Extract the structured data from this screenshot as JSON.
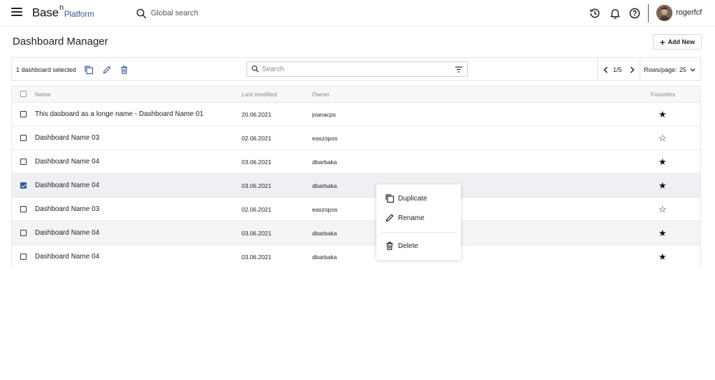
{
  "topbar": {
    "logo_main": "Base",
    "logo_sup": "n",
    "logo_sub": "Platform",
    "search_label": "Global search",
    "username": "rogerfcf",
    "icons": [
      "menu-icon",
      "search-icon",
      "history-icon",
      "bell-icon",
      "help-icon"
    ]
  },
  "page": {
    "title": "Dashboard Manager",
    "add_label": "Add New"
  },
  "toolbar": {
    "selected_text": "1 dashboard selected",
    "search_placeholder": "Search",
    "pager_text": "1/5",
    "rows_label": "Rows/page:",
    "rows_value": "25"
  },
  "table": {
    "headers": {
      "name": "Name",
      "last_modified": "Last modified",
      "owner": "Owner",
      "favorites": "Favorites"
    },
    "rows": [
      {
        "name": "This dasboard as a longe name - Dashboard Name 01",
        "date": "20.06.2021",
        "owner": "joanacps",
        "favorite": true,
        "checked": false
      },
      {
        "name": "Dashboard Name 03",
        "date": "02.06.2021",
        "owner": "easzopos",
        "favorite": false,
        "checked": false
      },
      {
        "name": "Dashboard Name 04",
        "date": "03.06.2021",
        "owner": "dbarbaka",
        "favorite": true,
        "checked": false
      },
      {
        "name": "Dashboard Name 04",
        "date": "03.06.2021",
        "owner": "dbarbaka",
        "favorite": true,
        "checked": true
      },
      {
        "name": "Dashboard Name 03",
        "date": "02.06.2021",
        "owner": "easzopos",
        "favorite": false,
        "checked": false
      },
      {
        "name": "Dashboard Name 04",
        "date": "03.06.2021",
        "owner": "dbarbaka",
        "favorite": true,
        "checked": false
      },
      {
        "name": "Dashboard Name 04",
        "date": "03.06.2021",
        "owner": "dbarbaka",
        "favorite": true,
        "checked": false
      }
    ]
  },
  "context_menu": {
    "duplicate": "Duplicate",
    "rename": "Rename",
    "delete": "Delete"
  },
  "colors": {
    "accent": "#2f5a9e",
    "logo_sub": "#3b5c8c",
    "selected_row": "#eef0f4"
  }
}
